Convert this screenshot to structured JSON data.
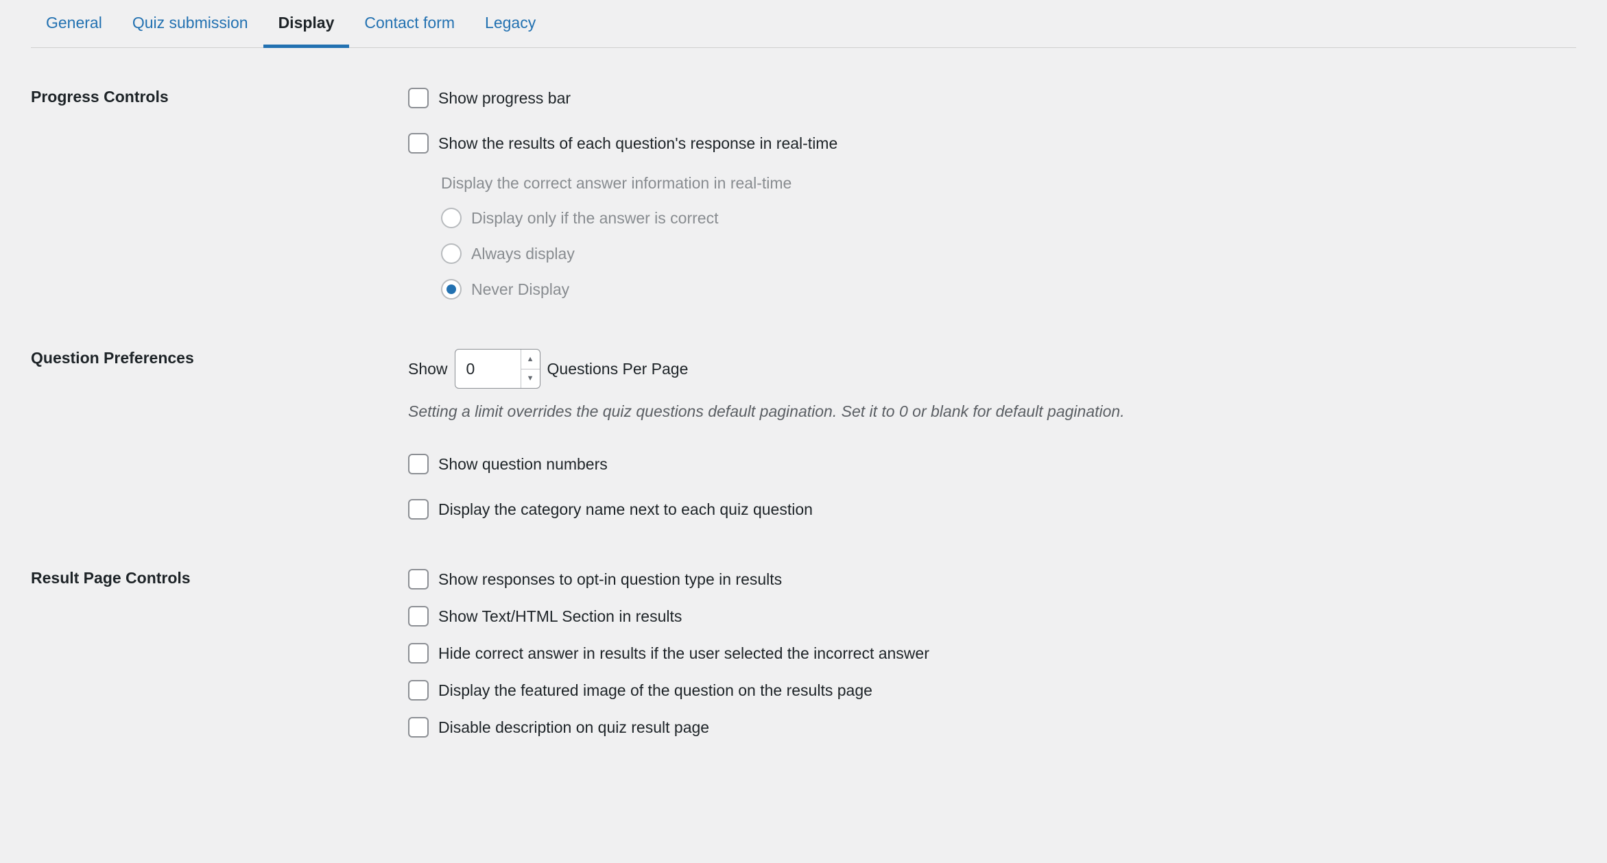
{
  "tabs": {
    "general": "General",
    "quiz_submission": "Quiz submission",
    "display": "Display",
    "contact_form": "Contact form",
    "legacy": "Legacy"
  },
  "progress": {
    "heading": "Progress Controls",
    "show_progress_bar": "Show progress bar",
    "show_results_real_time": "Show the results of each question's response in real-time",
    "sub_caption": "Display the correct answer information in real-time",
    "opt_only_correct": "Display only if the answer is correct",
    "opt_always": "Always display",
    "opt_never": "Never Display"
  },
  "question_prefs": {
    "heading": "Question Preferences",
    "show_prefix": "Show",
    "qpp_value": "0",
    "show_suffix": "Questions Per Page",
    "hint": "Setting a limit overrides the quiz questions default pagination. Set it to 0 or blank for default pagination.",
    "show_question_numbers": "Show question numbers",
    "display_category_name": "Display the category name next to each quiz question"
  },
  "result_page": {
    "heading": "Result Page Controls",
    "show_optin_responses": "Show responses to opt-in question type in results",
    "show_text_html": "Show Text/HTML Section in results",
    "hide_correct_if_wrong": "Hide correct answer in results if the user selected the incorrect answer",
    "display_featured_image": "Display the featured image of the question on the results page",
    "disable_description": "Disable description on quiz result page"
  }
}
